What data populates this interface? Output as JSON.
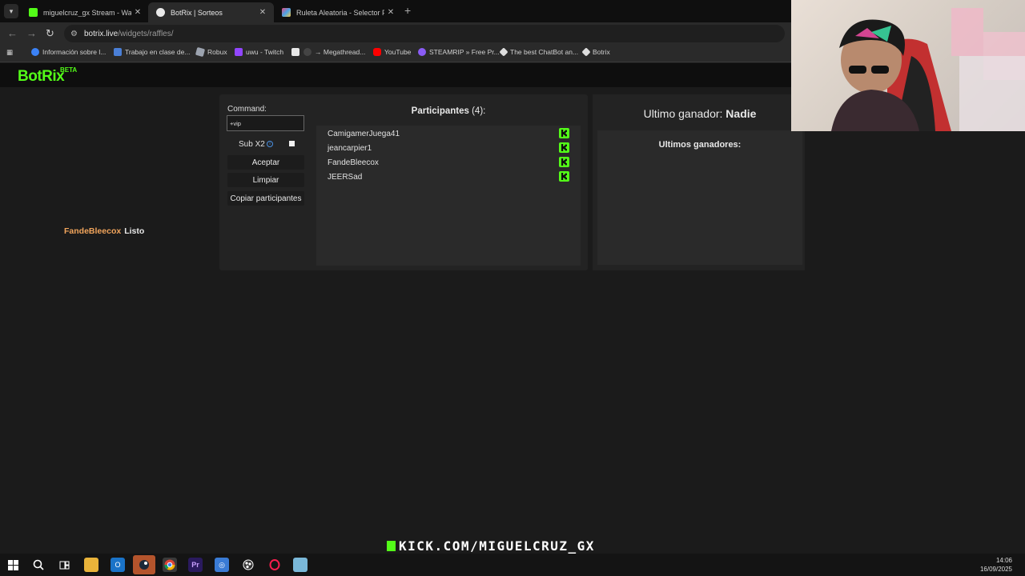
{
  "browser": {
    "tabs": [
      {
        "title": "miguelcruz_gx Stream - Watch",
        "favicon_color": "#53fc18",
        "active": false
      },
      {
        "title": "BotRix | Sorteos",
        "favicon_color": "#e8e8e8",
        "active": true
      },
      {
        "title": "Ruleta Aleatoria - Selector Pers",
        "favicon_color": "#e84a7a",
        "active": false
      }
    ],
    "url_host": "botrix.live",
    "url_path": "/widgets/raffles/",
    "bookmarks": [
      {
        "label": "Información sobre l...",
        "color": "#3b82f6"
      },
      {
        "label": "Trabajo en clase de...",
        "color": "#4a7fd6"
      },
      {
        "label": "Robux",
        "color": "#9ca3af"
      },
      {
        "label": "uwu - Twitch",
        "color": "#9146ff"
      },
      {
        "label": "",
        "color": "#e8e8e8"
      },
      {
        "label": "→ Megathread...",
        "color": "#444444"
      },
      {
        "label": "YouTube",
        "color": "#ff0000"
      },
      {
        "label": "STEAMRIP » Free Pr...",
        "color": "#8a5cf6"
      },
      {
        "label": "The best ChatBot an...",
        "color": "#dddddd"
      },
      {
        "label": "Botrix",
        "color": "#dddddd"
      }
    ]
  },
  "app": {
    "logo": "BotRix",
    "logo_badge": "BETA",
    "accent": "#53fc18"
  },
  "status": {
    "name": "FandeBleecox",
    "state": "Listo"
  },
  "controls": {
    "command_label": "Command:",
    "command_value": "+vip",
    "subx2_label": "Sub X2",
    "subx2_info": "i",
    "accept_label": "Aceptar",
    "clear_label": "Limpiar",
    "copy_label": "Copiar participantes"
  },
  "participants": {
    "title": "Participantes",
    "count": "(4):",
    "items": [
      {
        "name": "CamigamerJuega41"
      },
      {
        "name": "jeancarpier1"
      },
      {
        "name": "FandeBleecox"
      },
      {
        "name": "JEERSad"
      }
    ]
  },
  "winner": {
    "label": "Ultimo ganador:",
    "name": "Nadie",
    "list_title": "Ultimos ganadores:"
  },
  "overlay": {
    "text": "KICK.COM/MIGUELCRUZ_GX"
  },
  "taskbar": {
    "time": "14:06",
    "date": "16/09/2025"
  }
}
